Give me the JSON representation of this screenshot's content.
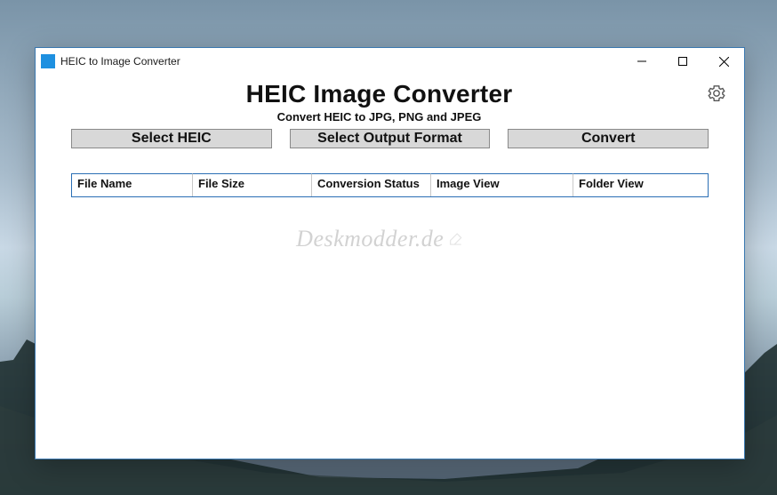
{
  "window": {
    "title": "HEIC to Image Converter"
  },
  "header": {
    "title": "HEIC Image Converter",
    "subtitle": "Convert HEIC to JPG, PNG and JPEG"
  },
  "buttons": {
    "select_heic": "Select HEIC",
    "select_output": "Select Output Format",
    "convert": "Convert"
  },
  "table": {
    "columns": {
      "file_name": "File Name",
      "file_size": "File Size",
      "conversion_status": "Conversion Status",
      "image_view": "Image View",
      "folder_view": "Folder View"
    }
  },
  "watermark": "Deskmodder.de",
  "icons": {
    "app": "HEIC",
    "minimize": "minimize-icon",
    "maximize": "maximize-icon",
    "close": "close-icon",
    "settings": "gear-icon"
  }
}
